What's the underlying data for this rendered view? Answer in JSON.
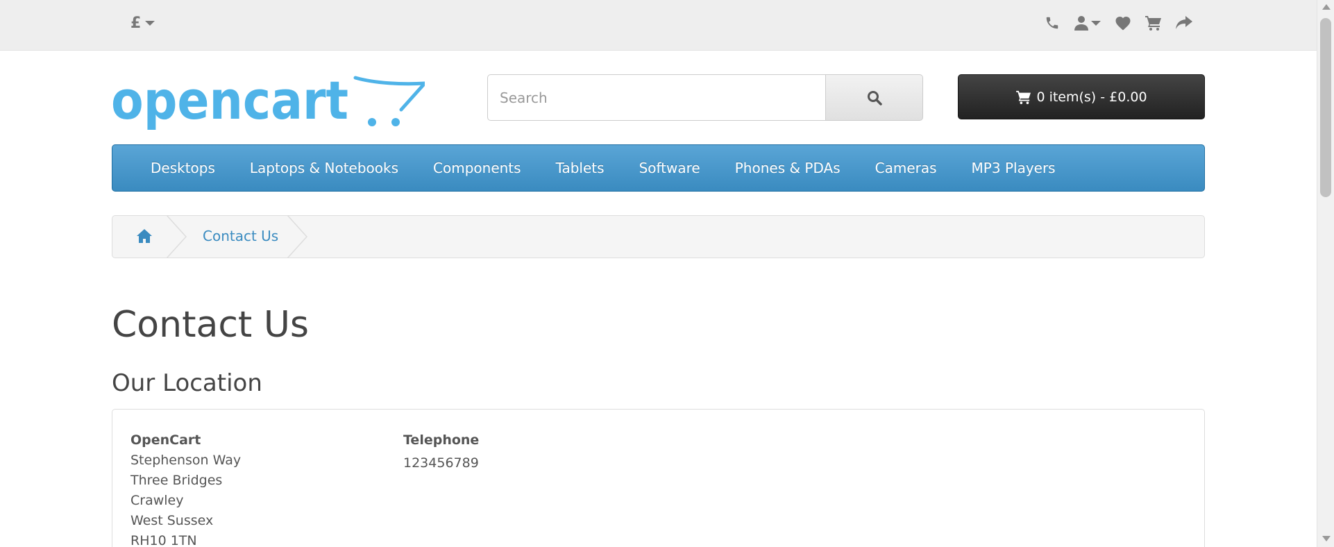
{
  "top_bar": {
    "currency_symbol": "£",
    "links": [
      {
        "icon": "phone-icon"
      },
      {
        "icon": "user-icon",
        "has_dropdown": true
      },
      {
        "icon": "heart-icon"
      },
      {
        "icon": "shopping-cart-icon"
      },
      {
        "icon": "share-icon"
      }
    ]
  },
  "header": {
    "logo_text": "opencart",
    "search": {
      "placeholder": "Search",
      "value": ""
    },
    "cart_label": "0 item(s) - £0.00"
  },
  "menu": {
    "items": [
      "Desktops",
      "Laptops & Notebooks",
      "Components",
      "Tablets",
      "Software",
      "Phones & PDAs",
      "Cameras",
      "MP3 Players"
    ]
  },
  "breadcrumb": {
    "home_icon": "home-icon",
    "current": "Contact Us"
  },
  "content": {
    "page_title": "Contact Us",
    "section_title": "Our Location",
    "address": {
      "name": "OpenCart",
      "lines": [
        "Stephenson Way",
        "Three Bridges",
        "Crawley",
        "West Sussex",
        "RH10 1TN"
      ]
    },
    "telephone": {
      "label": "Telephone",
      "value": "123456789"
    }
  },
  "colors": {
    "menu_blue": "#3a8bc0",
    "logo_blue": "#4fb3e8",
    "cart_dark": "#222222",
    "top_bar_bg": "#eeeeee"
  }
}
